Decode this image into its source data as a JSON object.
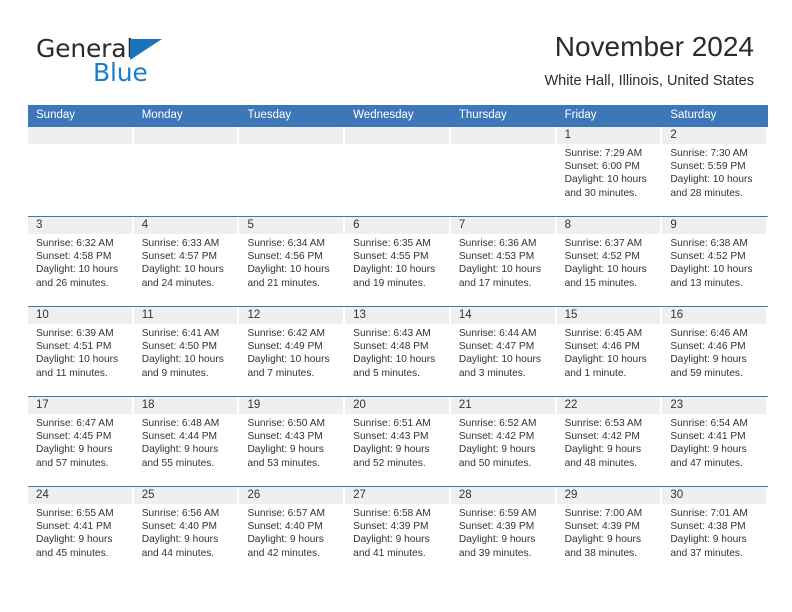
{
  "brand": {
    "word1": "General",
    "word2": "Blue",
    "triangle_color": "#1b72b8",
    "word2_color": "#1b80c8"
  },
  "header": {
    "title": "November 2024",
    "subtitle": "White Hall, Illinois, United States",
    "accent_color": "#3d77b8",
    "daynum_bg": "#efefef"
  },
  "weekdays": [
    "Sunday",
    "Monday",
    "Tuesday",
    "Wednesday",
    "Thursday",
    "Friday",
    "Saturday"
  ],
  "weeks": [
    [
      {
        "day": "",
        "sunrise": "",
        "sunset": "",
        "daylight1": "",
        "daylight2": "",
        "empty": true
      },
      {
        "day": "",
        "sunrise": "",
        "sunset": "",
        "daylight1": "",
        "daylight2": "",
        "empty": true
      },
      {
        "day": "",
        "sunrise": "",
        "sunset": "",
        "daylight1": "",
        "daylight2": "",
        "empty": true
      },
      {
        "day": "",
        "sunrise": "",
        "sunset": "",
        "daylight1": "",
        "daylight2": "",
        "empty": true
      },
      {
        "day": "",
        "sunrise": "",
        "sunset": "",
        "daylight1": "",
        "daylight2": "",
        "empty": true
      },
      {
        "day": "1",
        "sunrise": "Sunrise: 7:29 AM",
        "sunset": "Sunset: 6:00 PM",
        "daylight1": "Daylight: 10 hours",
        "daylight2": "and 30 minutes."
      },
      {
        "day": "2",
        "sunrise": "Sunrise: 7:30 AM",
        "sunset": "Sunset: 5:59 PM",
        "daylight1": "Daylight: 10 hours",
        "daylight2": "and 28 minutes."
      }
    ],
    [
      {
        "day": "3",
        "sunrise": "Sunrise: 6:32 AM",
        "sunset": "Sunset: 4:58 PM",
        "daylight1": "Daylight: 10 hours",
        "daylight2": "and 26 minutes."
      },
      {
        "day": "4",
        "sunrise": "Sunrise: 6:33 AM",
        "sunset": "Sunset: 4:57 PM",
        "daylight1": "Daylight: 10 hours",
        "daylight2": "and 24 minutes."
      },
      {
        "day": "5",
        "sunrise": "Sunrise: 6:34 AM",
        "sunset": "Sunset: 4:56 PM",
        "daylight1": "Daylight: 10 hours",
        "daylight2": "and 21 minutes."
      },
      {
        "day": "6",
        "sunrise": "Sunrise: 6:35 AM",
        "sunset": "Sunset: 4:55 PM",
        "daylight1": "Daylight: 10 hours",
        "daylight2": "and 19 minutes."
      },
      {
        "day": "7",
        "sunrise": "Sunrise: 6:36 AM",
        "sunset": "Sunset: 4:53 PM",
        "daylight1": "Daylight: 10 hours",
        "daylight2": "and 17 minutes."
      },
      {
        "day": "8",
        "sunrise": "Sunrise: 6:37 AM",
        "sunset": "Sunset: 4:52 PM",
        "daylight1": "Daylight: 10 hours",
        "daylight2": "and 15 minutes."
      },
      {
        "day": "9",
        "sunrise": "Sunrise: 6:38 AM",
        "sunset": "Sunset: 4:52 PM",
        "daylight1": "Daylight: 10 hours",
        "daylight2": "and 13 minutes."
      }
    ],
    [
      {
        "day": "10",
        "sunrise": "Sunrise: 6:39 AM",
        "sunset": "Sunset: 4:51 PM",
        "daylight1": "Daylight: 10 hours",
        "daylight2": "and 11 minutes."
      },
      {
        "day": "11",
        "sunrise": "Sunrise: 6:41 AM",
        "sunset": "Sunset: 4:50 PM",
        "daylight1": "Daylight: 10 hours",
        "daylight2": "and 9 minutes."
      },
      {
        "day": "12",
        "sunrise": "Sunrise: 6:42 AM",
        "sunset": "Sunset: 4:49 PM",
        "daylight1": "Daylight: 10 hours",
        "daylight2": "and 7 minutes."
      },
      {
        "day": "13",
        "sunrise": "Sunrise: 6:43 AM",
        "sunset": "Sunset: 4:48 PM",
        "daylight1": "Daylight: 10 hours",
        "daylight2": "and 5 minutes."
      },
      {
        "day": "14",
        "sunrise": "Sunrise: 6:44 AM",
        "sunset": "Sunset: 4:47 PM",
        "daylight1": "Daylight: 10 hours",
        "daylight2": "and 3 minutes."
      },
      {
        "day": "15",
        "sunrise": "Sunrise: 6:45 AM",
        "sunset": "Sunset: 4:46 PM",
        "daylight1": "Daylight: 10 hours",
        "daylight2": "and 1 minute."
      },
      {
        "day": "16",
        "sunrise": "Sunrise: 6:46 AM",
        "sunset": "Sunset: 4:46 PM",
        "daylight1": "Daylight: 9 hours",
        "daylight2": "and 59 minutes."
      }
    ],
    [
      {
        "day": "17",
        "sunrise": "Sunrise: 6:47 AM",
        "sunset": "Sunset: 4:45 PM",
        "daylight1": "Daylight: 9 hours",
        "daylight2": "and 57 minutes."
      },
      {
        "day": "18",
        "sunrise": "Sunrise: 6:48 AM",
        "sunset": "Sunset: 4:44 PM",
        "daylight1": "Daylight: 9 hours",
        "daylight2": "and 55 minutes."
      },
      {
        "day": "19",
        "sunrise": "Sunrise: 6:50 AM",
        "sunset": "Sunset: 4:43 PM",
        "daylight1": "Daylight: 9 hours",
        "daylight2": "and 53 minutes."
      },
      {
        "day": "20",
        "sunrise": "Sunrise: 6:51 AM",
        "sunset": "Sunset: 4:43 PM",
        "daylight1": "Daylight: 9 hours",
        "daylight2": "and 52 minutes."
      },
      {
        "day": "21",
        "sunrise": "Sunrise: 6:52 AM",
        "sunset": "Sunset: 4:42 PM",
        "daylight1": "Daylight: 9 hours",
        "daylight2": "and 50 minutes."
      },
      {
        "day": "22",
        "sunrise": "Sunrise: 6:53 AM",
        "sunset": "Sunset: 4:42 PM",
        "daylight1": "Daylight: 9 hours",
        "daylight2": "and 48 minutes."
      },
      {
        "day": "23",
        "sunrise": "Sunrise: 6:54 AM",
        "sunset": "Sunset: 4:41 PM",
        "daylight1": "Daylight: 9 hours",
        "daylight2": "and 47 minutes."
      }
    ],
    [
      {
        "day": "24",
        "sunrise": "Sunrise: 6:55 AM",
        "sunset": "Sunset: 4:41 PM",
        "daylight1": "Daylight: 9 hours",
        "daylight2": "and 45 minutes."
      },
      {
        "day": "25",
        "sunrise": "Sunrise: 6:56 AM",
        "sunset": "Sunset: 4:40 PM",
        "daylight1": "Daylight: 9 hours",
        "daylight2": "and 44 minutes."
      },
      {
        "day": "26",
        "sunrise": "Sunrise: 6:57 AM",
        "sunset": "Sunset: 4:40 PM",
        "daylight1": "Daylight: 9 hours",
        "daylight2": "and 42 minutes."
      },
      {
        "day": "27",
        "sunrise": "Sunrise: 6:58 AM",
        "sunset": "Sunset: 4:39 PM",
        "daylight1": "Daylight: 9 hours",
        "daylight2": "and 41 minutes."
      },
      {
        "day": "28",
        "sunrise": "Sunrise: 6:59 AM",
        "sunset": "Sunset: 4:39 PM",
        "daylight1": "Daylight: 9 hours",
        "daylight2": "and 39 minutes."
      },
      {
        "day": "29",
        "sunrise": "Sunrise: 7:00 AM",
        "sunset": "Sunset: 4:39 PM",
        "daylight1": "Daylight: 9 hours",
        "daylight2": "and 38 minutes."
      },
      {
        "day": "30",
        "sunrise": "Sunrise: 7:01 AM",
        "sunset": "Sunset: 4:38 PM",
        "daylight1": "Daylight: 9 hours",
        "daylight2": "and 37 minutes."
      }
    ]
  ]
}
